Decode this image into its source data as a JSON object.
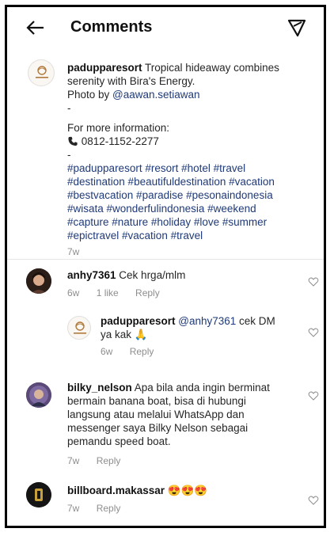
{
  "header": {
    "title": "Comments",
    "back_icon": "arrow-left-icon",
    "filter_icon": "filter-icon"
  },
  "caption": {
    "username": "padupparesort",
    "text_line1": " Tropical hideaway combines",
    "text_line2": "serenity with Bira's Energy.",
    "photo_by": "Photo by ",
    "photo_mention": "@aawan.setiawan",
    "dash": "-",
    "more_info": "For more information:",
    "phone": "0812-1152-2277",
    "hashtags": [
      "#padupparesort #resort #hotel #travel",
      "#destination #beautifuldestination #vacation",
      "#bestvacation #paradise #pesonaindonesia",
      "#wisata #wonderfulindonesia #weekend",
      "#capture #nature #holiday #love #summer",
      "#epictravel #vacation #travel"
    ],
    "time": "7w"
  },
  "comments": [
    {
      "username": "anhy7361",
      "text": " Cek hrga/mlm",
      "time": "6w",
      "likes": "1 like",
      "reply": "Reply"
    },
    {
      "username": "padupparesort",
      "mention": " @anhy7361",
      "text_line1": " cek DM",
      "text_line2": "ya kak ",
      "emoji": "🙏",
      "time": "6w",
      "reply": "Reply"
    },
    {
      "username": "bilky_nelson",
      "text_line1": " Apa bila anda ingin berminat",
      "text_line2": "bermain banana boat, bisa di hubungi",
      "text_line3": "langsung atau melalui WhatsApp dan",
      "text_line4": "messenger saya Bilky Nelson sebagai",
      "text_line5": "pemandu speed boat.",
      "time": "7w",
      "reply": "Reply"
    },
    {
      "username": "billboard.makassar",
      "text": " 😍😍😍",
      "time": "7w",
      "reply": "Reply"
    }
  ],
  "colors": {
    "hashtag": "#1f3a78",
    "meta": "#8e8e8e",
    "border": "#000000"
  }
}
